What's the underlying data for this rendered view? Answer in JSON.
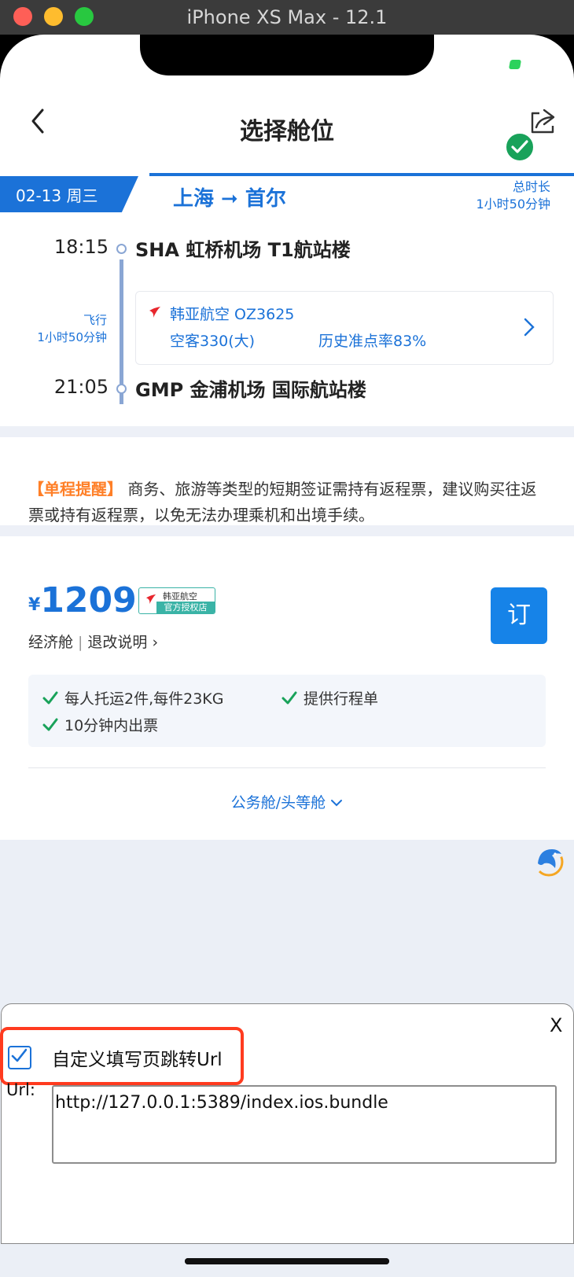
{
  "simulator": {
    "title": "iPhone XS Max - 12.1"
  },
  "header": {
    "title": "选择舱位"
  },
  "route": {
    "date": "02-13 周三",
    "cities": "上海 ➞ 首尔",
    "total_label": "总时长",
    "total_duration": "1小时50分钟"
  },
  "segment": {
    "depart_time": "18:15",
    "depart_airport": "SHA 虹桥机场 T1航站楼",
    "arrive_time": "21:05",
    "arrive_airport": "GMP 金浦机场 国际航站楼",
    "fly_label": "飞行",
    "fly_duration": "1小时50分钟",
    "airline": "韩亚航空 OZ3625",
    "aircraft": "空客330(大)",
    "on_time": "历史准点率83%"
  },
  "notice": {
    "tag": "【单程提醒】",
    "text": " 商务、旅游等类型的短期签证需持有返程票，建议购买往返票或持有返程票，以免无法办理乘机和出境手续。"
  },
  "offer": {
    "currency": "¥",
    "price": "1209",
    "auth_top": "韩亚航空",
    "auth_bottom": "官方授权店",
    "cabin": "经济舱",
    "rules_link": "退改说明",
    "book_label": "订",
    "features": [
      "每人托运2件,每件23KG",
      "提供行程单",
      "10分钟内出票"
    ],
    "more_cabins": "公务舱/头等舱"
  },
  "debug_panel": {
    "close_label": "X",
    "checkbox_label": "自定义填写页跳转Url",
    "checked": true,
    "url_label": "Url:",
    "url_value": "http://127.0.0.1:5389/index.ios.bundle"
  },
  "colors": {
    "primary": "#1b72d8",
    "accent_orange": "#ff7f27",
    "check_green": "#19a25a",
    "highlight_red": "#ff3b1f"
  }
}
